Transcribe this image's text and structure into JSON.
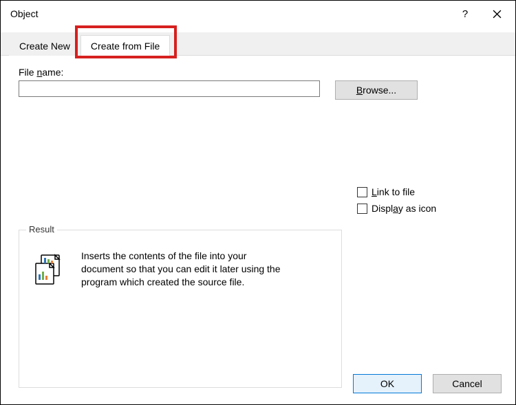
{
  "title": "Object",
  "help_char": "?",
  "tabs": {
    "create_new": "Create New",
    "create_from_file": "Create from File"
  },
  "body": {
    "file_label_pre": "File ",
    "file_label_u": "n",
    "file_label_post": "ame:",
    "file_value": "",
    "browse_pre": "",
    "browse_u": "B",
    "browse_post": "rowse...",
    "link_pre": "",
    "link_u": "L",
    "link_post": "ink to file",
    "display_pre": "Displ",
    "display_u": "a",
    "display_post": "y as icon"
  },
  "result": {
    "legend": "Result",
    "text": "Inserts the contents of the file into your document so that you can edit it later using the program which created the source file."
  },
  "footer": {
    "ok": "OK",
    "cancel": "Cancel"
  }
}
